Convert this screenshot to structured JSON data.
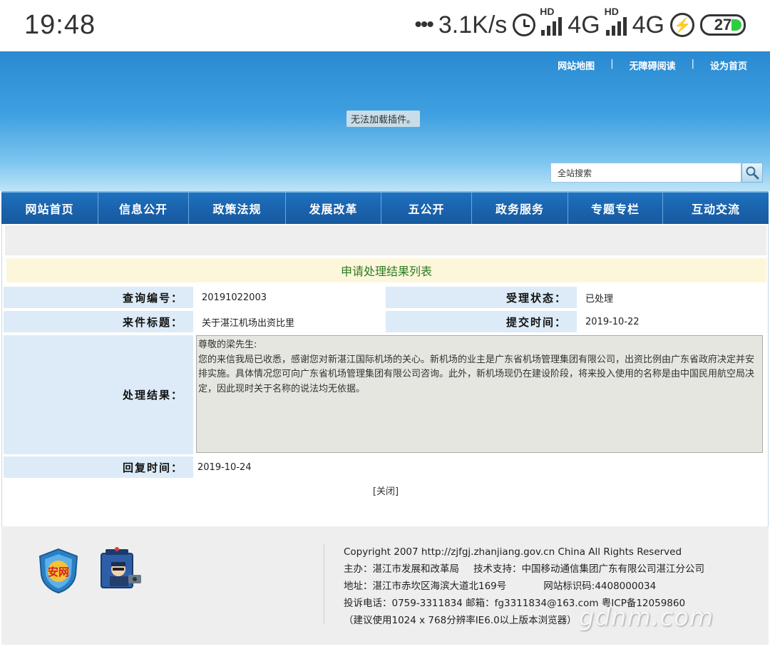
{
  "statusbar": {
    "time": "19:48",
    "net_speed": "3.1K/s",
    "net1": "4G",
    "net2": "4G",
    "hd": "HD",
    "battery": "27"
  },
  "header": {
    "links": [
      "网站地图",
      "无障碍阅读",
      "设为首页"
    ],
    "separator": "|",
    "plugin_message": "无法加载插件。",
    "search_value": "全站搜索"
  },
  "nav": {
    "items": [
      "网站首页",
      "信息公开",
      "政策法规",
      "发展改革",
      "五公开",
      "政务服务",
      "专题专栏",
      "互动交流"
    ]
  },
  "main": {
    "title": "申请处理结果列表",
    "query_no_label": "查询编号：",
    "query_no": "20191022003",
    "status_label": "受理状态：",
    "status": "已处理",
    "subject_label": "来件标题：",
    "subject": "关于湛江机场出资比里",
    "submit_time_label": "提交时间：",
    "submit_time": "2019-10-22",
    "result_label": "处理结果：",
    "result_text": "尊敬的梁先生:\n您的来信我局已收悉，感谢您对新湛江国际机场的关心。新机场的业主是广东省机场管理集团有限公司，出资比例由广东省政府决定并安排实施。具体情况您可向广东省机场管理集团有限公司咨询。此外，新机场现仍在建设阶段，将来投入使用的名称是由中国民用航空局决定，因此现时关于名称的说法均无依据。",
    "reply_time_label": "回复时间：",
    "reply_time": "2019-10-24",
    "close_link": "[关闭]"
  },
  "footer": {
    "copyright": "Copyright 2007 http://zjfgj.zhanjiang.gov.cn China All Rights Reserved",
    "host": "主办：湛江市发展和改革局",
    "support": "技术支持：中国移动通信集团广东有限公司湛江分公司",
    "address": "地址：湛江市赤坎区海滨大道北169号",
    "site_id": "网站标识码:4408000034",
    "phone": "投诉电话：0759-3311834",
    "email": "邮箱：fg3311834@163.com",
    "icp": "粤ICP备12059860",
    "browser_note": "（建议使用1024 x 768分辨率IE6.0以上版本浏览器）",
    "badge1_text": "安网",
    "watermark": "gdnm.com"
  },
  "colors": {
    "header_blue": "#2a8ad2",
    "nav_blue": "#1b63ad",
    "title_green": "#2d7a23",
    "label_bg": "#dcebf7"
  }
}
